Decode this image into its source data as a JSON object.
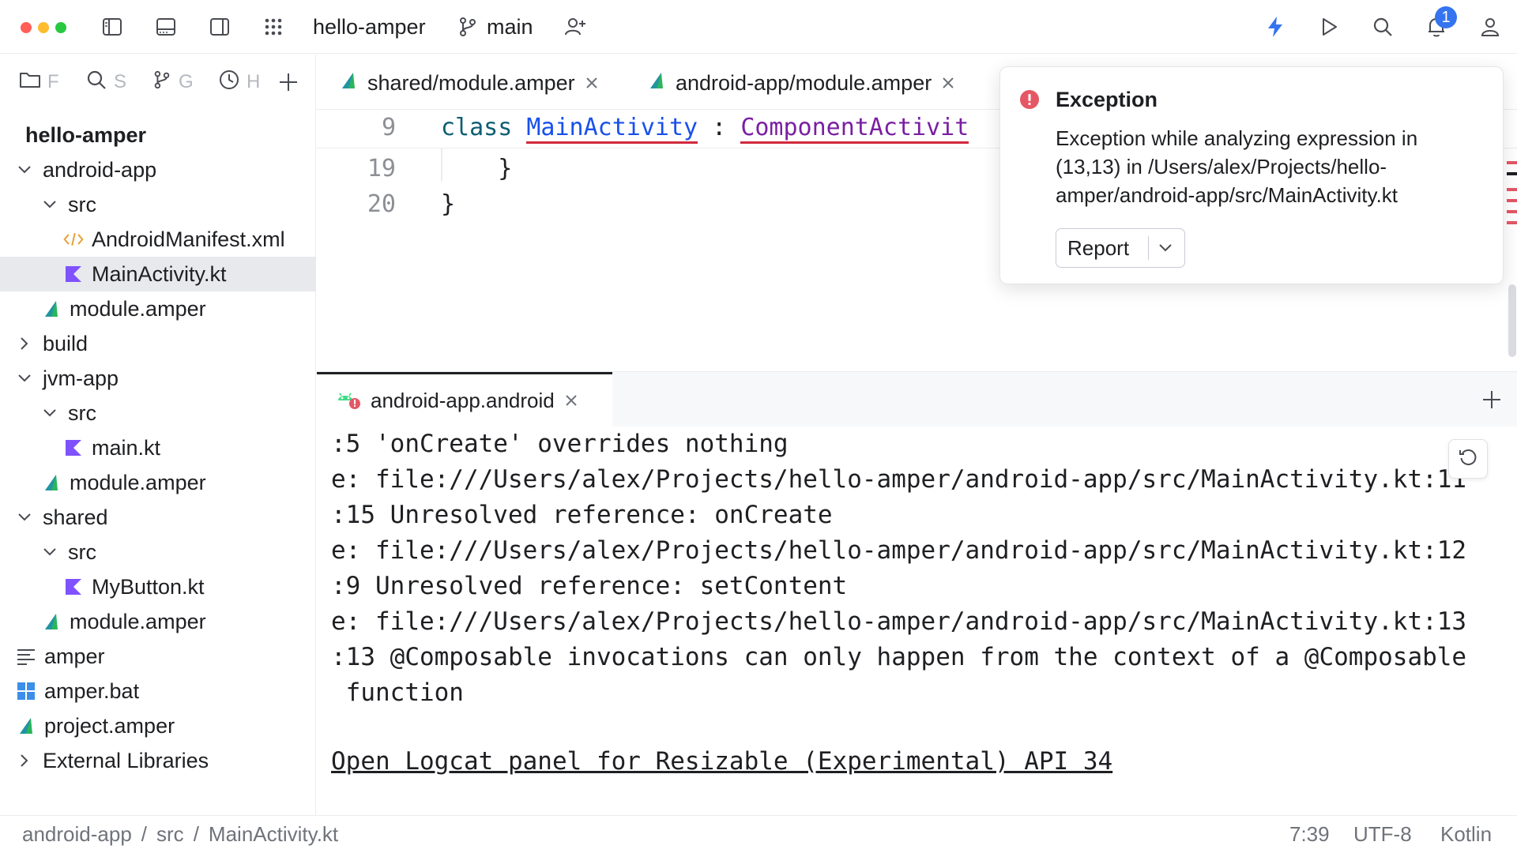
{
  "colors": {
    "traffic_red": "#ff5f57",
    "traffic_yellow": "#febc2e",
    "traffic_green": "#28c840",
    "accent_blue": "#3574f0",
    "error_red": "#e55765",
    "kotlin_purple": "#7f52ff",
    "amper_green": "#2bb55c"
  },
  "titlebar": {
    "project_name": "hello-amper",
    "branch": "main",
    "notification_count": "1"
  },
  "sidebar": {
    "tabs": [
      {
        "icon": "folder-icon",
        "label": "F"
      },
      {
        "icon": "search-icon",
        "label": "S"
      },
      {
        "icon": "git-branch-icon",
        "label": "G"
      },
      {
        "icon": "clock-icon",
        "label": "H"
      }
    ],
    "root": "hello-amper",
    "items": [
      {
        "label": "android-app",
        "icon": "chevron-down-icon"
      },
      {
        "label": "src",
        "icon": "chevron-down-icon"
      },
      {
        "label": "AndroidManifest.xml",
        "icon": "xml-icon"
      },
      {
        "label": "MainActivity.kt",
        "icon": "kotlin-icon"
      },
      {
        "label": "module.amper",
        "icon": "amper-icon"
      },
      {
        "label": "build",
        "icon": "chevron-right-icon"
      },
      {
        "label": "jvm-app",
        "icon": "chevron-down-icon"
      },
      {
        "label": "src",
        "icon": "chevron-down-icon"
      },
      {
        "label": "main.kt",
        "icon": "kotlin-icon"
      },
      {
        "label": "module.amper",
        "icon": "amper-icon"
      },
      {
        "label": "shared",
        "icon": "chevron-down-icon"
      },
      {
        "label": "src",
        "icon": "chevron-down-icon"
      },
      {
        "label": "MyButton.kt",
        "icon": "kotlin-icon"
      },
      {
        "label": "module.amper",
        "icon": "amper-icon"
      },
      {
        "label": "amper",
        "icon": "text-file-icon"
      },
      {
        "label": "amper.bat",
        "icon": "windows-icon"
      },
      {
        "label": "project.amper",
        "icon": "amper-icon"
      },
      {
        "label": "External Libraries",
        "icon": "chevron-right-icon"
      }
    ]
  },
  "editor": {
    "tabs": [
      {
        "label": "shared/module.amper"
      },
      {
        "label": "android-app/module.amper"
      }
    ],
    "lines": [
      {
        "num": "9",
        "kw": "class ",
        "name": "MainActivity",
        "sep": " : ",
        "type": "ComponentActivit"
      },
      {
        "num": "19",
        "text": "    }"
      },
      {
        "num": "20",
        "text": "}"
      }
    ]
  },
  "notification": {
    "title": "Exception",
    "body": "Exception while analyzing expression in (13,13) in /Users/alex/Projects/hello-amper/android-app/src/MainActivity.kt",
    "report_label": "Report"
  },
  "terminal": {
    "tab_label": "android-app.android",
    "lines": [
      ":5 'onCreate' overrides nothing",
      "e: file:///Users/alex/Projects/hello-amper/android-app/src/MainActivity.kt:11",
      ":15 Unresolved reference: onCreate",
      "e: file:///Users/alex/Projects/hello-amper/android-app/src/MainActivity.kt:12",
      ":9 Unresolved reference: setContent",
      "e: file:///Users/alex/Projects/hello-amper/android-app/src/MainActivity.kt:13",
      ":13 @Composable invocations can only happen from the context of a @Composable",
      " function"
    ],
    "link": "Open Logcat panel for Resizable (Experimental) API 34"
  },
  "statusbar": {
    "breadcrumb": [
      "android-app",
      "src",
      "MainActivity.kt"
    ],
    "separator": "/",
    "position": "7:39",
    "encoding": "UTF-8",
    "language": "Kotlin"
  }
}
